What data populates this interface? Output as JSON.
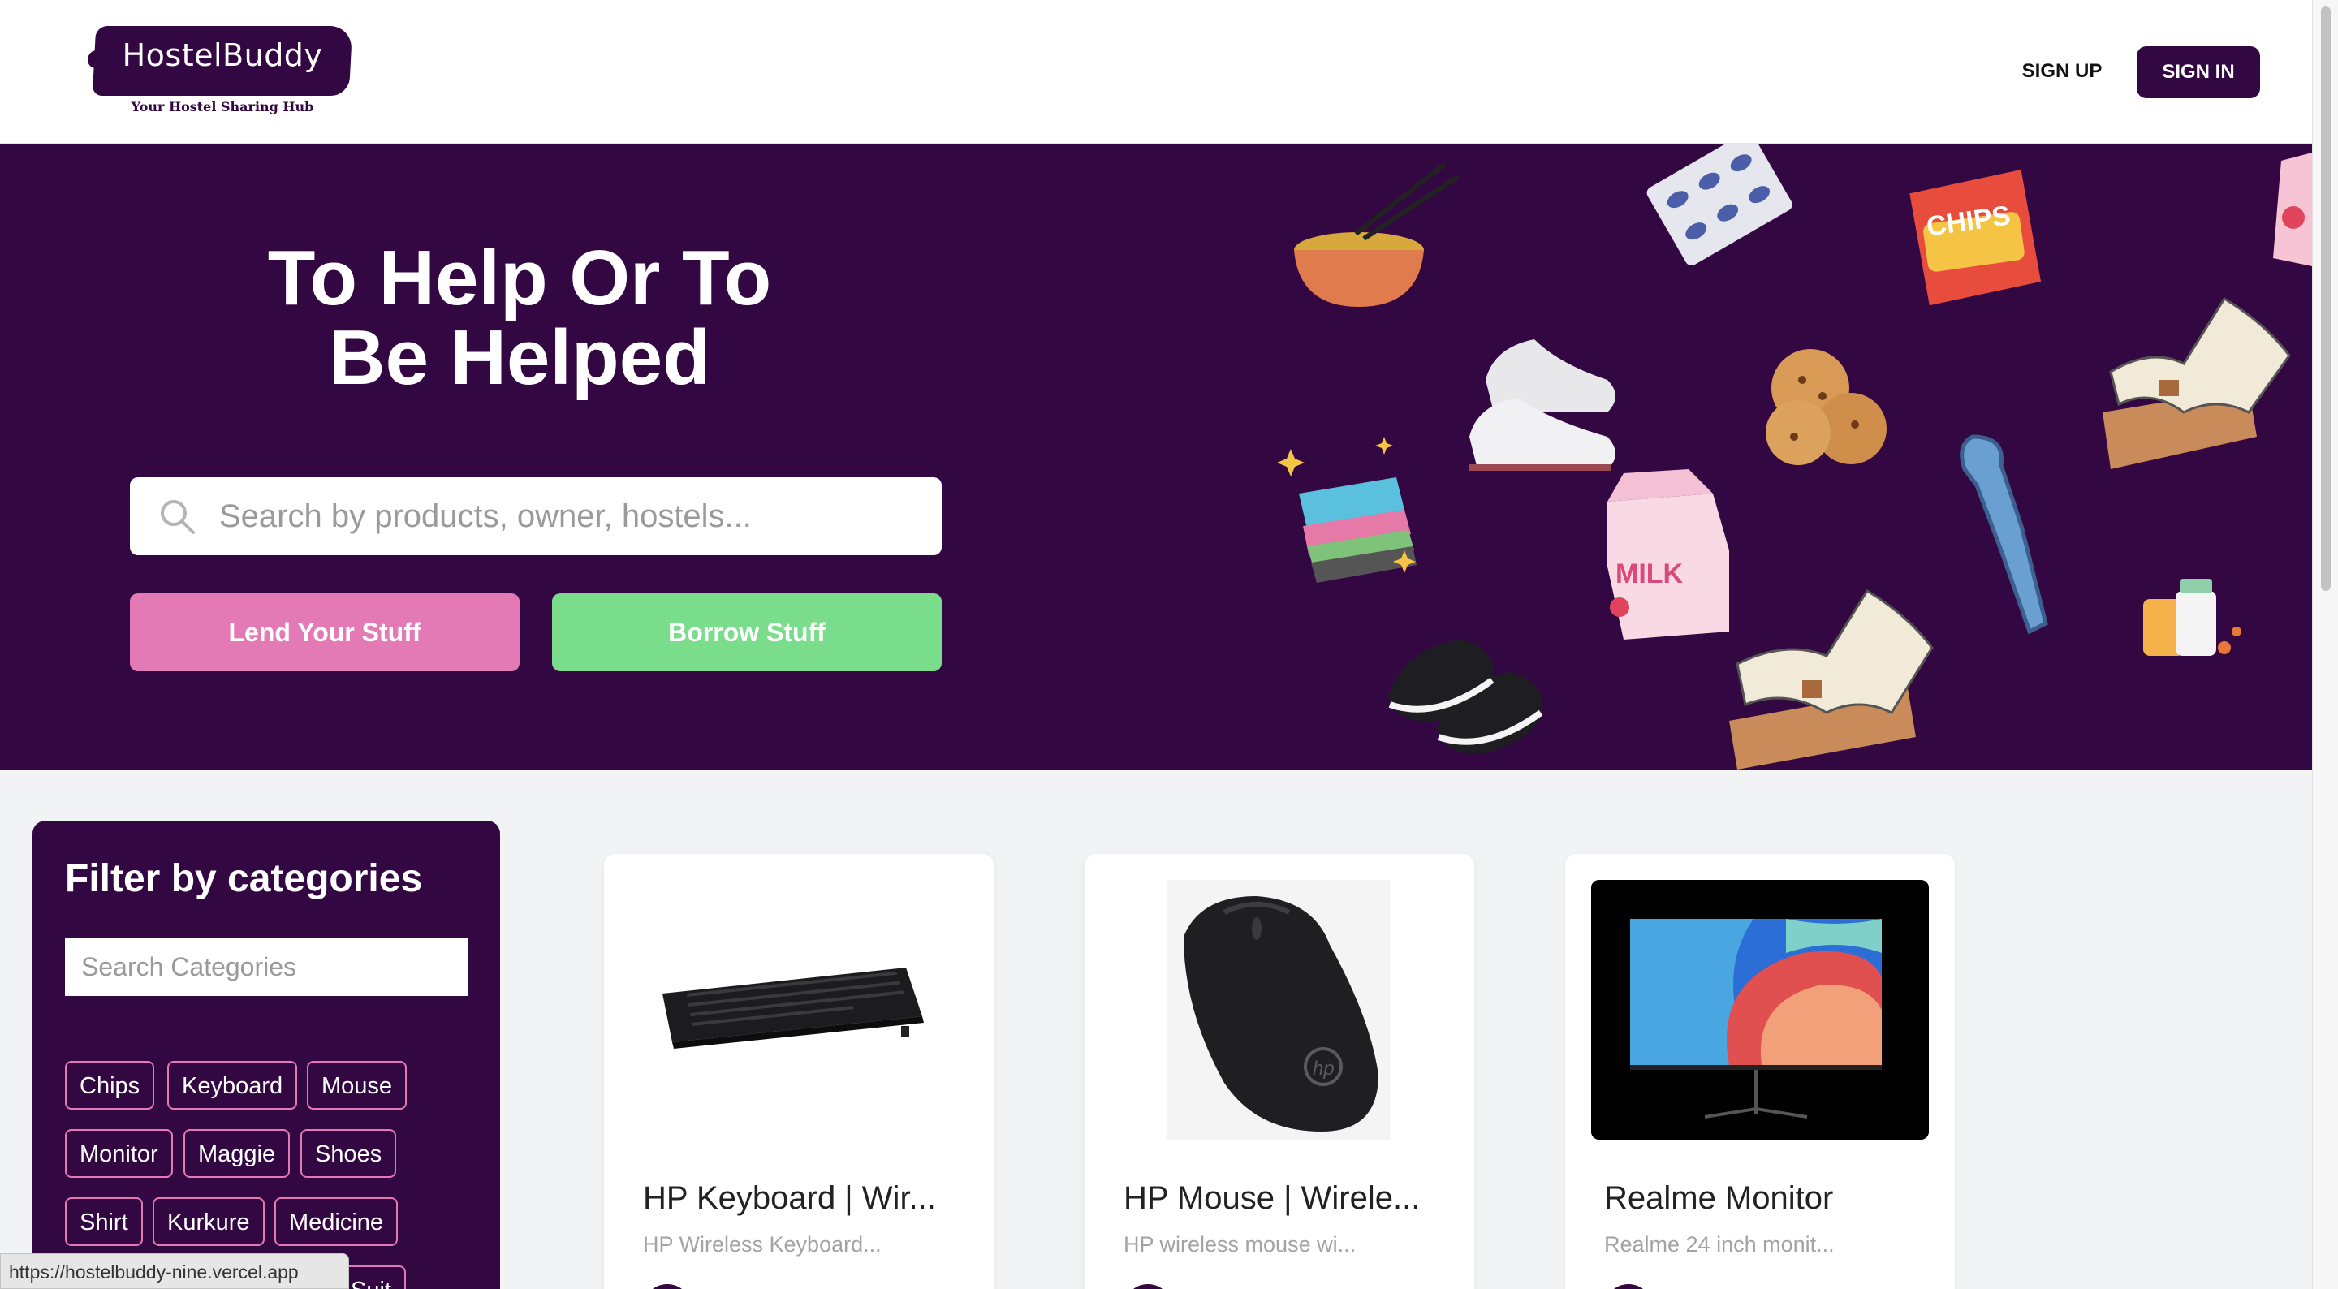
{
  "header": {
    "logo_title": "HostelBuddy",
    "logo_subtitle": "Your Hostel Sharing Hub",
    "signup_label": "SIGN UP",
    "signin_label": "SIGN IN"
  },
  "hero": {
    "title_line1": "To Help Or To",
    "title_line2": "Be Helped",
    "search_placeholder": "Search by products, owner, hostels...",
    "lend_label": "Lend Your Stuff",
    "borrow_label": "Borrow Stuff",
    "illustration_labels": {
      "chips": "CHIPS",
      "milk": "MILK"
    }
  },
  "sidebar": {
    "title": "Filter by categories",
    "search_placeholder": "Search Categories",
    "categories": [
      "Chips",
      "Keyboard",
      "Mouse",
      "Monitor",
      "Maggie",
      "Shoes",
      "Shirt",
      "Kurkure",
      "Medicine",
      "Suit"
    ]
  },
  "products": [
    {
      "name": "HP Keyboard | Wir...",
      "description": "HP Wireless Keyboard..."
    },
    {
      "name": "HP Mouse | Wirele...",
      "description": "HP wireless mouse wi..."
    },
    {
      "name": "Realme Monitor",
      "description": "Realme 24 inch monit..."
    }
  ],
  "status_url": "https://hostelbuddy-nine.vercel.app",
  "colors": {
    "brand": "#330742",
    "lend": "#e37ab6",
    "borrow": "#79dd8c",
    "background": "#f2f3f5"
  }
}
